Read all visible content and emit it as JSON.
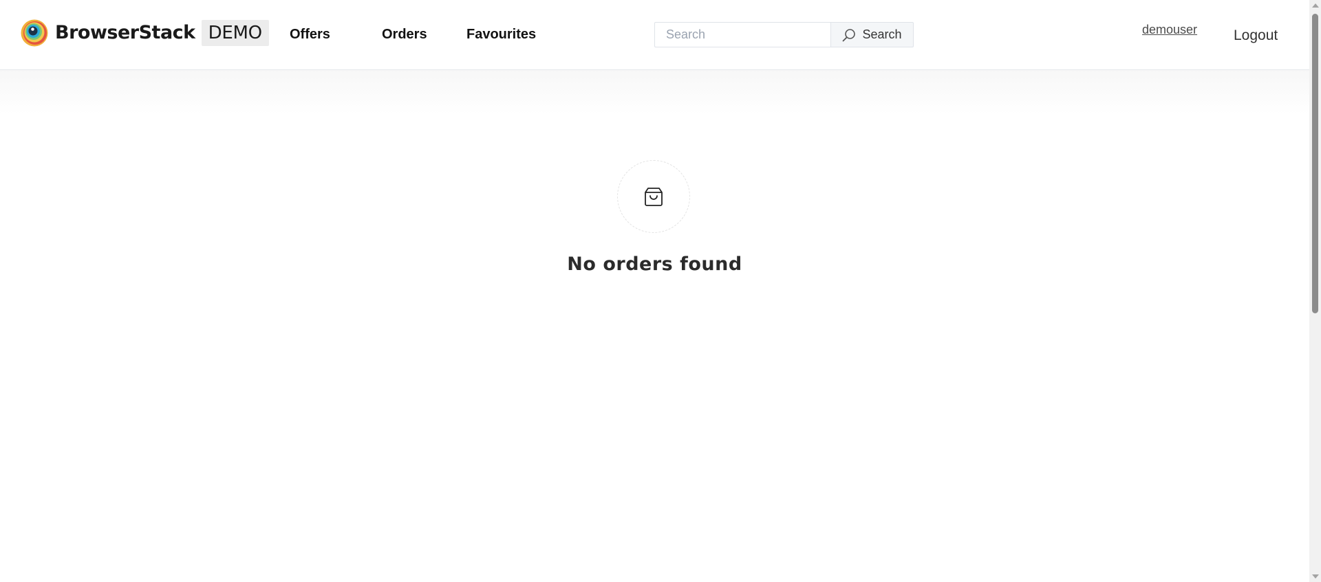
{
  "header": {
    "logo": {
      "name": "BrowserStack",
      "badge": "DEMO"
    },
    "nav": [
      {
        "label": "Offers"
      },
      {
        "label": "Orders"
      },
      {
        "label": "Favourites"
      }
    ],
    "search": {
      "placeholder": "Search",
      "value": "",
      "button_label": "Search",
      "button_icon": "search-icon"
    },
    "user": {
      "username": "demouser",
      "logout_label": "Logout"
    }
  },
  "main": {
    "empty_state": {
      "icon": "shopping-bag-icon",
      "message": "No orders found"
    }
  },
  "colors": {
    "text": "#111111",
    "muted_text": "#4b4b4b",
    "placeholder": "#9aa3b0",
    "border": "#dfe3e8",
    "search_button_bg": "#f4f6f8",
    "logo_badge_bg": "#ececec"
  }
}
